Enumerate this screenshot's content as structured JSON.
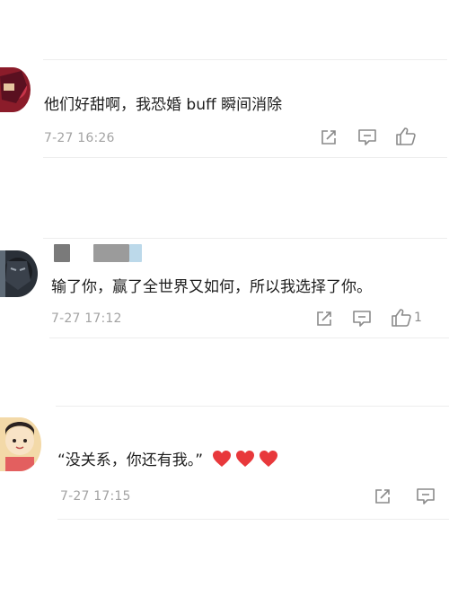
{
  "comments": [
    {
      "text": "他们好甜啊，我恐婚 buff 瞬间消除",
      "time": "7-27 16:26",
      "like_count": ""
    },
    {
      "text": "输了你，赢了全世界又如何，所以我选择了你。",
      "time": "7-27 17:12",
      "like_count": "1"
    },
    {
      "text": "“没关系，你还有我。”",
      "time": "7-27 17:15",
      "like_count": ""
    }
  ],
  "colors": {
    "heart": "#e8383b",
    "timestamp": "#a3a3a3",
    "icon": "#8a8a8a",
    "divider": "#ededed"
  }
}
